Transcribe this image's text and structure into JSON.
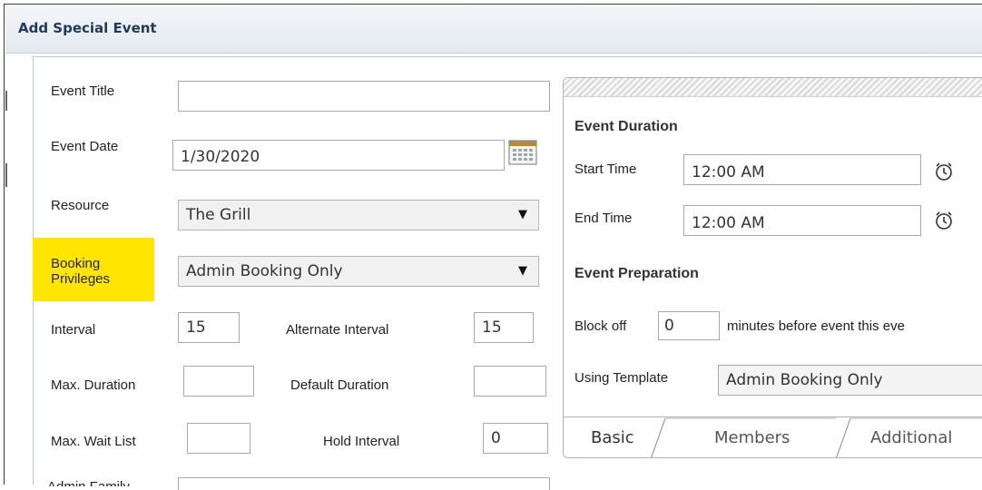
{
  "dialog": {
    "title": "Add Special Event"
  },
  "form": {
    "event_title": {
      "label": "Event Title",
      "value": ""
    },
    "event_date": {
      "label": "Event Date",
      "value": "1/30/2020"
    },
    "resource": {
      "label": "Resource",
      "value": "The Grill"
    },
    "booking_privileges": {
      "label_line1": "Booking",
      "label_line2": "Privileges",
      "value": "Admin Booking Only",
      "highlight_color": "#ffe600"
    },
    "interval": {
      "label": "Interval",
      "value": "15"
    },
    "alternate_interval": {
      "label": "Alternate Interval",
      "value": "15"
    },
    "max_duration": {
      "label": "Max. Duration",
      "value": ""
    },
    "default_duration": {
      "label": "Default Duration",
      "value": ""
    },
    "max_wait_list": {
      "label": "Max. Wait List",
      "value": ""
    },
    "hold_interval": {
      "label": "Hold Interval",
      "value": "0"
    },
    "admin_family": {
      "label": "Admin Family"
    }
  },
  "event_panel": {
    "duration_heading": "Event Duration",
    "start_time": {
      "label": "Start Time",
      "value": "12:00 AM"
    },
    "end_time": {
      "label": "End Time",
      "value": "12:00 AM"
    },
    "preparation_heading": "Event Preparation",
    "block_off": {
      "prefix": "Block off",
      "value": "0",
      "suffix": "minutes before event this eve"
    },
    "using_template": {
      "label": "Using Template",
      "value": "Admin Booking Only"
    },
    "tabs": [
      {
        "label": "Basic"
      },
      {
        "label": "Members"
      },
      {
        "label": "Additional"
      }
    ]
  },
  "icons": {
    "calendar": "calendar-icon",
    "clock": "alarm-clock-icon",
    "dropdown": "dropdown-arrow-icon"
  }
}
